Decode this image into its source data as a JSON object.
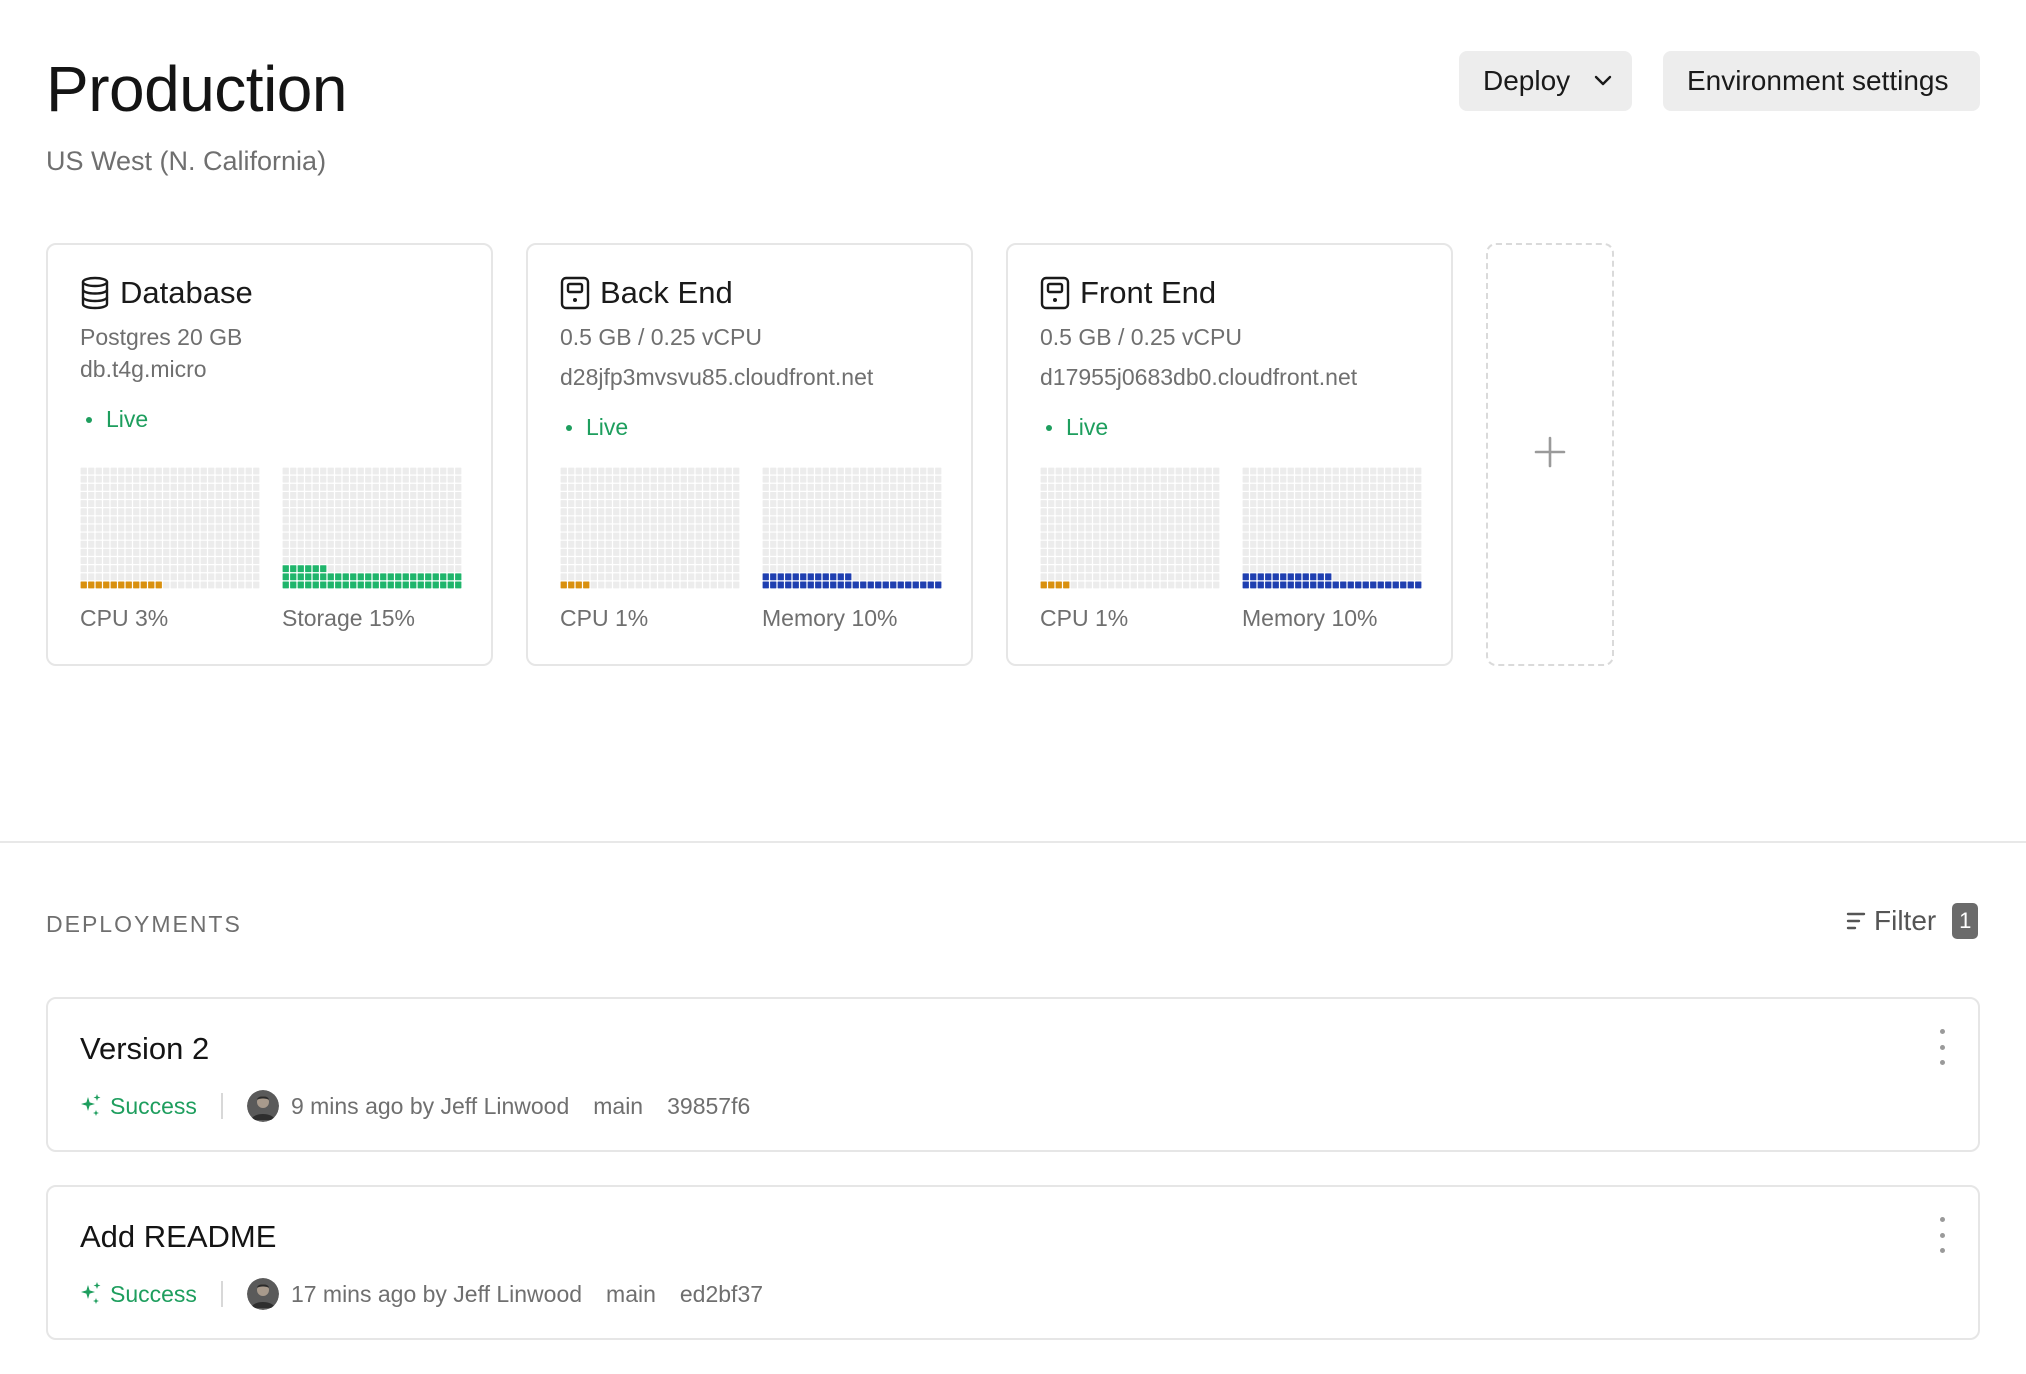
{
  "header": {
    "title": "Production",
    "region": "US West (N. California)",
    "deploy_label": "Deploy",
    "env_settings_label": "Environment settings"
  },
  "services": [
    {
      "name": "Database",
      "icon": "database-icon",
      "line1": "Postgres 20 GB",
      "line2": "db.t4g.micro",
      "status": "Live",
      "metrics": [
        {
          "label": "CPU 3%",
          "percent": 3,
          "color": "#d9900e"
        },
        {
          "label": "Storage 15%",
          "percent": 15,
          "color": "#1fb56b"
        }
      ]
    },
    {
      "name": "Back End",
      "icon": "server-icon",
      "line1": "0.5 GB / 0.25 vCPU",
      "line2": "d28jfp3mvsvu85.cloudfront.net",
      "status": "Live",
      "metrics": [
        {
          "label": "CPU 1%",
          "percent": 1,
          "color": "#d9900e"
        },
        {
          "label": "Memory 10%",
          "percent": 10,
          "color": "#1f3fb0"
        }
      ]
    },
    {
      "name": "Front End",
      "icon": "server-icon",
      "line1": "0.5 GB / 0.25 vCPU",
      "line2": "d17955j0683db0.cloudfront.net",
      "status": "Live",
      "metrics": [
        {
          "label": "CPU 1%",
          "percent": 1,
          "color": "#d9900e"
        },
        {
          "label": "Memory 10%",
          "percent": 10,
          "color": "#1f3fb0"
        }
      ]
    }
  ],
  "deployments": {
    "section_title": "DEPLOYMENTS",
    "filter_label": "Filter",
    "filter_count": "1",
    "items": [
      {
        "title": "Version 2",
        "status": "Success",
        "time_by": "9 mins ago by Jeff Linwood",
        "branch": "main",
        "commit": "39857f6"
      },
      {
        "title": "Add README",
        "status": "Success",
        "time_by": "17 mins ago by Jeff Linwood",
        "branch": "main",
        "commit": "ed2bf37"
      }
    ]
  },
  "colors": {
    "live": "#1e9e5e",
    "cpu": "#d9900e",
    "storage": "#1fb56b",
    "memory": "#1f3fb0",
    "grid_empty": "#ececec"
  }
}
